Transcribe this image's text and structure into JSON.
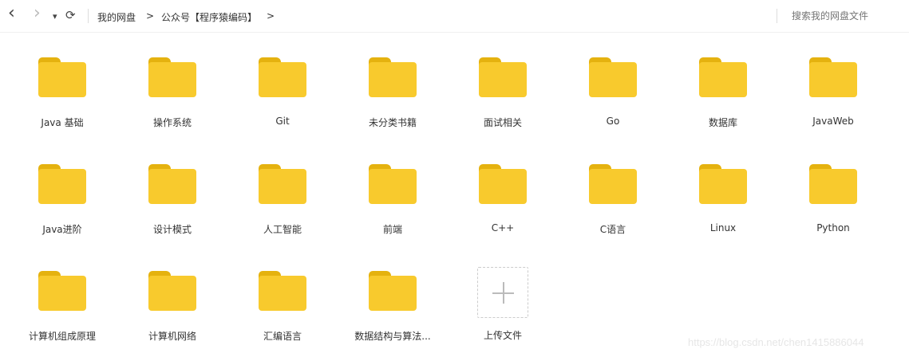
{
  "toolbar": {
    "back": "‹",
    "forward": "›",
    "dropdown": "▾",
    "refresh": "⟳",
    "breadcrumb": [
      "我的网盘",
      "公众号【程序猿编码】"
    ],
    "crumb_sep": ">",
    "search_placeholder": "搜索我的网盘文件"
  },
  "folders": [
    "Java 基础",
    "操作系统",
    "Git",
    "未分类书籍",
    "面试相关",
    "Go",
    "数据库",
    "JavaWeb",
    "Java进阶",
    "设计模式",
    "人工智能",
    "前端",
    "C++",
    "C语言",
    "Linux",
    "Python",
    "计算机组成原理",
    "计算机网络",
    "汇编语言",
    "数据结构与算法..."
  ],
  "upload_label": "上传文件",
  "watermark": "https://blog.csdn.net/chen1415886044",
  "colors": {
    "folder": "#f8ca2d",
    "folder_tab": "#e5b20f"
  }
}
